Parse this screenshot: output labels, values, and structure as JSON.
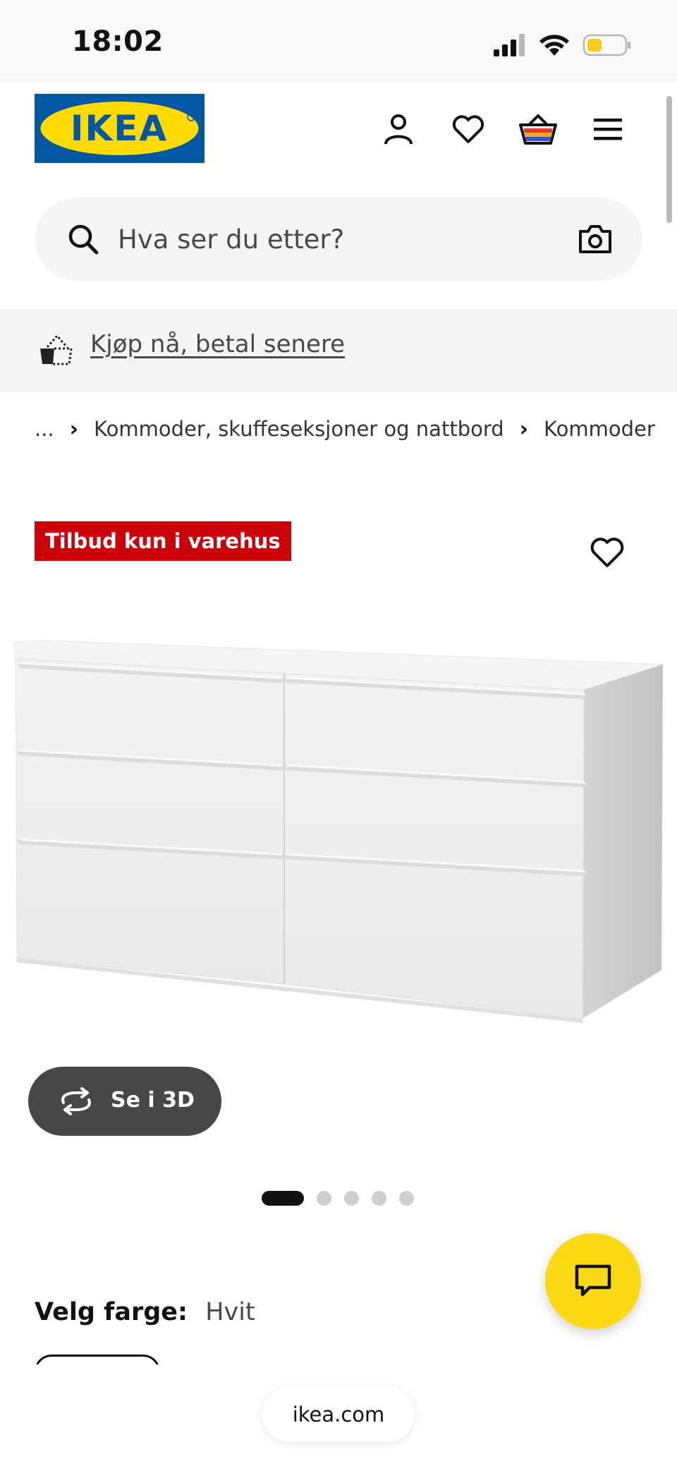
{
  "status_bar": {
    "time": "18:02"
  },
  "header": {
    "logo_text": "IKEA",
    "icons": [
      "profile-icon",
      "heart-icon",
      "basket-icon",
      "menu-icon"
    ]
  },
  "search": {
    "placeholder": "Hva ser du etter?"
  },
  "promo": {
    "link_text": "Kjøp nå, betal senere"
  },
  "breadcrumb": {
    "ellipsis": "...",
    "items": [
      "Kommoder, skuffeseksjoner og nattbord",
      "Kommoder"
    ]
  },
  "product": {
    "badge": "Tilbud kun i varehus",
    "view_3d_label": "Se i 3D",
    "carousel": {
      "total": 5,
      "active_index": 0
    },
    "color": {
      "label": "Velg farge:",
      "value": "Hvit"
    }
  },
  "browser": {
    "url": "ikea.com"
  },
  "colors": {
    "ikea_blue": "#0058a3",
    "ikea_yellow": "#ffdb00",
    "badge_red": "#cc0008",
    "chat_yellow": "#fbd914"
  }
}
